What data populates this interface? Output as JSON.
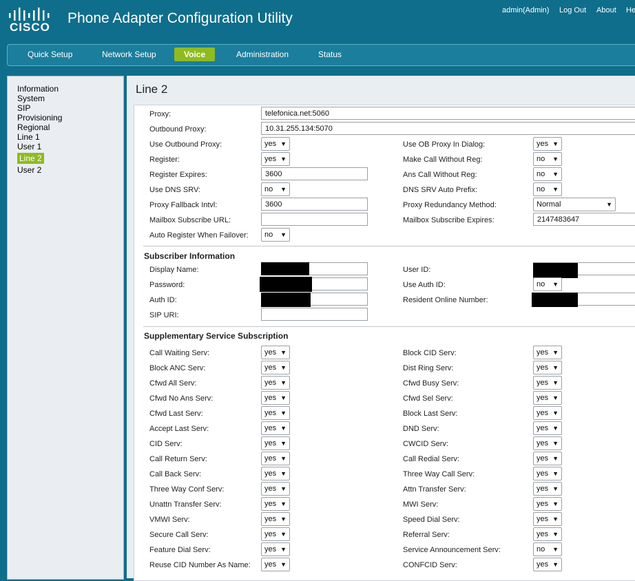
{
  "header": {
    "logo_text": "CISCO",
    "title": "Phone Adapter Configuration Utility",
    "user": "admin(Admin)",
    "logout": "Log Out",
    "about": "About",
    "help": "He"
  },
  "nav": {
    "quick_setup": "Quick Setup",
    "network_setup": "Network Setup",
    "voice": "Voice",
    "administration": "Administration",
    "status": "Status"
  },
  "sidebar": {
    "items": [
      "Information",
      "System",
      "SIP",
      "Provisioning",
      "Regional",
      "Line 1",
      "User 1",
      "Line 2",
      "User 2"
    ]
  },
  "page": {
    "title": "Line 2"
  },
  "proxy": {
    "proxy_label": "Proxy:",
    "proxy_value": "telefonica.net:5060",
    "outbound_proxy_label": "Outbound Proxy:",
    "outbound_proxy_value": "10.31.255.134:5070",
    "use_outbound_proxy_label": "Use Outbound Proxy:",
    "use_outbound_proxy_value": "yes",
    "use_ob_proxy_dialog_label": "Use OB Proxy In Dialog:",
    "use_ob_proxy_dialog_value": "yes",
    "register_label": "Register:",
    "register_value": "yes",
    "make_call_without_reg_label": "Make Call Without Reg:",
    "make_call_without_reg_value": "no",
    "register_expires_label": "Register Expires:",
    "register_expires_value": "3600",
    "ans_call_without_reg_label": "Ans Call Without Reg:",
    "ans_call_without_reg_value": "no",
    "use_dns_srv_label": "Use DNS SRV:",
    "use_dns_srv_value": "no",
    "dns_srv_auto_prefix_label": "DNS SRV Auto Prefix:",
    "dns_srv_auto_prefix_value": "no",
    "proxy_fallback_label": "Proxy Fallback Intvl:",
    "proxy_fallback_value": "3600",
    "proxy_redundancy_label": "Proxy Redundancy Method:",
    "proxy_redundancy_value": "Normal",
    "mailbox_url_label": "Mailbox Subscribe URL:",
    "mailbox_url_value": "",
    "mailbox_expires_label": "Mailbox Subscribe Expires:",
    "mailbox_expires_value": "2147483647",
    "auto_register_label": "Auto Register When Failover:",
    "auto_register_value": "no"
  },
  "subscriber": {
    "section_title": "Subscriber Information",
    "display_name_label": "Display Name:",
    "user_id_label": "User ID:",
    "password_label": "Password:",
    "use_auth_id_label": "Use Auth ID:",
    "use_auth_id_value": "no",
    "auth_id_label": "Auth ID:",
    "resident_online_label": "Resident Online Number:",
    "sip_uri_label": "SIP URI:",
    "sip_uri_value": ""
  },
  "supplementary": {
    "section_title": "Supplementary Service Subscription",
    "left": [
      {
        "label": "Call Waiting Serv:",
        "value": "yes"
      },
      {
        "label": "Block ANC Serv:",
        "value": "yes"
      },
      {
        "label": "Cfwd All Serv:",
        "value": "yes"
      },
      {
        "label": "Cfwd No Ans Serv:",
        "value": "yes"
      },
      {
        "label": "Cfwd Last Serv:",
        "value": "yes"
      },
      {
        "label": "Accept Last Serv:",
        "value": "yes"
      },
      {
        "label": "CID Serv:",
        "value": "yes"
      },
      {
        "label": "Call Return Serv:",
        "value": "yes"
      },
      {
        "label": "Call Back Serv:",
        "value": "yes"
      },
      {
        "label": "Three Way Conf Serv:",
        "value": "yes"
      },
      {
        "label": "Unattn Transfer Serv:",
        "value": "yes"
      },
      {
        "label": "VMWI Serv:",
        "value": "yes"
      },
      {
        "label": "Secure Call Serv:",
        "value": "yes"
      },
      {
        "label": "Feature Dial Serv:",
        "value": "yes"
      },
      {
        "label": "Reuse CID Number As Name:",
        "value": "yes"
      }
    ],
    "right": [
      {
        "label": "Block CID Serv:",
        "value": "yes"
      },
      {
        "label": "Dist Ring Serv:",
        "value": "yes"
      },
      {
        "label": "Cfwd Busy Serv:",
        "value": "yes"
      },
      {
        "label": "Cfwd Sel Serv:",
        "value": "yes"
      },
      {
        "label": "Block Last Serv:",
        "value": "yes"
      },
      {
        "label": "DND Serv:",
        "value": "yes"
      },
      {
        "label": "CWCID Serv:",
        "value": "yes"
      },
      {
        "label": "Call Redial Serv:",
        "value": "yes"
      },
      {
        "label": "Three Way Call Serv:",
        "value": "yes"
      },
      {
        "label": "Attn Transfer Serv:",
        "value": "yes"
      },
      {
        "label": "MWI Serv:",
        "value": "yes"
      },
      {
        "label": "Speed Dial Serv:",
        "value": "yes"
      },
      {
        "label": "Referral Serv:",
        "value": "yes"
      },
      {
        "label": "Service Announcement Serv:",
        "value": "no"
      },
      {
        "label": "CONFCID Serv:",
        "value": "yes"
      }
    ]
  },
  "icons": {
    "dropdown": "chevron-down-icon"
  }
}
